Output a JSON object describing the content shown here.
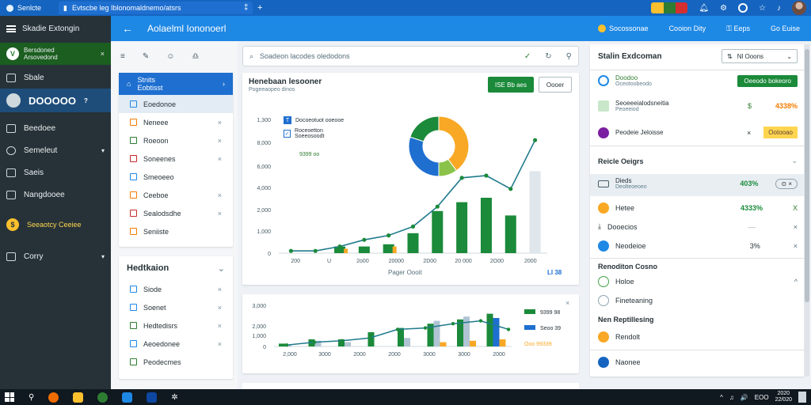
{
  "browser": {
    "brand": "Senlcte",
    "tab_title": "Evtscbe leg Iblonomaldnemo/atsrs",
    "tab_close": "⁑",
    "new_tab": "+",
    "ext_colors": [
      "#fbc02d",
      "#2e7d32",
      "#d32f2f"
    ]
  },
  "sidebar": {
    "header": "Skadie Extongin",
    "selected": {
      "logo": "V",
      "line1": "Bersdoned",
      "line2": "Arsovedond",
      "close": "×"
    },
    "items": [
      {
        "label": "Sbale",
        "icon": "home-icon"
      },
      {
        "label": "DOOOOO",
        "icon": "avatar-icon",
        "badge": "?"
      },
      {
        "label": "Beedoee",
        "icon": "box-icon"
      },
      {
        "label": "Semeleut",
        "icon": "user-icon",
        "chevron": "▾"
      },
      {
        "label": "Saeis",
        "icon": "list-icon"
      },
      {
        "label": "Nangdooee",
        "icon": "briefcase-icon"
      },
      {
        "label": "Seeaotcy Ceeiee",
        "icon": "coin-icon"
      },
      {
        "label": "Corry",
        "icon": "home-icon",
        "chevron": "▾"
      }
    ]
  },
  "header": {
    "back": "←",
    "title": "Aolaelml Iononoerl",
    "right": [
      "Socossonae",
      "Cooion Dity",
      "Eeps",
      "Go Euise"
    ]
  },
  "filters": {
    "tools": [
      "≡",
      "✎",
      "☺",
      "♎"
    ],
    "card1": {
      "head": {
        "line1": "Stnits",
        "line2": "Eobtisst"
      },
      "rows": [
        "Eoedonoe",
        "Neneee",
        "Roeoon",
        "Soneenes",
        "Smeoeeo",
        "Ceeboe",
        "Sealodsdhe",
        "Seniiste"
      ]
    },
    "card2": {
      "title": "Hedtkaion",
      "rows": [
        "Siode",
        "Soenet",
        "Hedtedisrs",
        "Aeoedonee",
        "Peodecmes"
      ]
    }
  },
  "search": {
    "placeholder": "Soadeon lacodes oledodons"
  },
  "chart": {
    "title": "Henebaan lesooner",
    "subtitle": "Pogeeaopeo dinos",
    "btn_primary": "ISE Bb aes",
    "btn_secondary": "Oooer",
    "legend": [
      {
        "label": "Docoeotuot ooeooe",
        "icon": "T"
      },
      {
        "label": "Roceoetton Soeeosoodt",
        "icon": "✓"
      }
    ],
    "legend_green": "9399 oo",
    "xlabel": "Pager Oooit",
    "badge": "LI 38"
  },
  "chart_data": [
    {
      "type": "bar",
      "categories": [
        "200",
        "U",
        "2o00",
        "20000",
        "2D00",
        "20 000",
        "2O00",
        "2000"
      ],
      "yticks": [
        "0",
        "1,000",
        "2,000",
        "4,000",
        "6,000",
        "8,000",
        "1,300"
      ],
      "series": [
        {
          "values": [
            0,
            0,
            0.3,
            0.3,
            0.4,
            0.9,
            1.9,
            2.3,
            2.5,
            1.7,
            3.7
          ]
        },
        {
          "values": [
            0.1,
            0.1,
            0.3,
            0.6,
            0.8,
            1.2,
            2.1,
            3.4,
            3.5,
            2.9,
            5.1
          ]
        }
      ],
      "donut": [
        {
          "value": 40,
          "color": "#f9a825"
        },
        {
          "value": 10,
          "color": "#8bc34a"
        },
        {
          "value": 30,
          "color": "#1e6fd0"
        },
        {
          "value": 20,
          "color": "#1b8a3a"
        }
      ]
    },
    {
      "type": "bar",
      "categories": [
        "2,000",
        "3000",
        "2000",
        "2000",
        "3000",
        "3000",
        "2000"
      ],
      "yticks": [
        "0",
        "1,000",
        "2,000",
        "3,000"
      ],
      "legend": [
        "9399 98",
        "Seoo 39",
        "Ooo 99339"
      ],
      "legend_colors": [
        "#1b8a3a",
        "#1e6fd0",
        "#f9a825"
      ]
    }
  ],
  "right_panel": {
    "title": "Stalin Exdcoman",
    "btn": "Nl Ooons",
    "rows1": [
      {
        "line1": "Doodoo",
        "line2": "Oceotoobeodo",
        "action": "Oeeodo bokeoro"
      },
      {
        "line1": "Seoeeeialodsneitia",
        "line2": "Peoeeiod",
        "icon2": "$",
        "value": "4338%"
      },
      {
        "line1": "Peodeie Jeloisse",
        "close": "×",
        "action": "Ootooao"
      }
    ],
    "section1": "Reicle Oeigrs",
    "sel_row": {
      "line1": "Dieds",
      "line2": "Deolteoeoeo",
      "value": "403%",
      "close": "×"
    },
    "rows2": [
      {
        "label": "Hetee",
        "value": "4333%",
        "close": "X"
      },
      {
        "label": "Dooecios",
        "value": "—",
        "close": "×"
      },
      {
        "label": "Neodeioe",
        "value": "3%",
        "close": "×"
      }
    ],
    "section2": "Renoditon Cosno",
    "rows3": [
      {
        "label": "Holoe",
        "chevron": "^"
      },
      {
        "label": "Fineteaning"
      }
    ],
    "section3": "Nen Reptillesing",
    "rows4": [
      {
        "label": "Rendolt"
      },
      {
        "label": "Naonee"
      }
    ]
  },
  "taskbar": {
    "tray": [
      "^",
      "♫",
      "🔊",
      "EOO"
    ],
    "clock": [
      "2020",
      "22/020"
    ]
  }
}
